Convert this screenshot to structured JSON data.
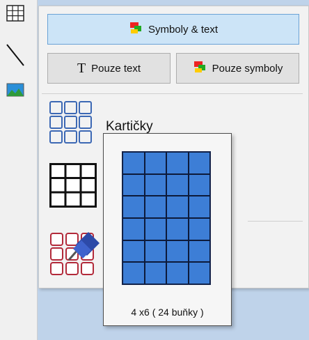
{
  "toolbar": {
    "tools": [
      {
        "icon": "table-grid-icon"
      },
      {
        "icon": "line-tool-icon"
      },
      {
        "icon": "image-icon"
      }
    ]
  },
  "panel": {
    "symbols_text_label": "Symboly & text",
    "text_only_label": "Pouze text",
    "symbols_only_label": "Pouze symboly",
    "text_only_glyph": "T",
    "cards_label": "Kartičky"
  },
  "popup": {
    "caption": "4 x6 ( 24 buňky )",
    "columns": 4,
    "rows": 6,
    "cell_color": "#3d7ed6"
  },
  "colors": {
    "selected_button_bg": "#cce4f7",
    "cards_icon_border": "#3c68b4",
    "pinned_icon_border": "#b22a3a"
  }
}
